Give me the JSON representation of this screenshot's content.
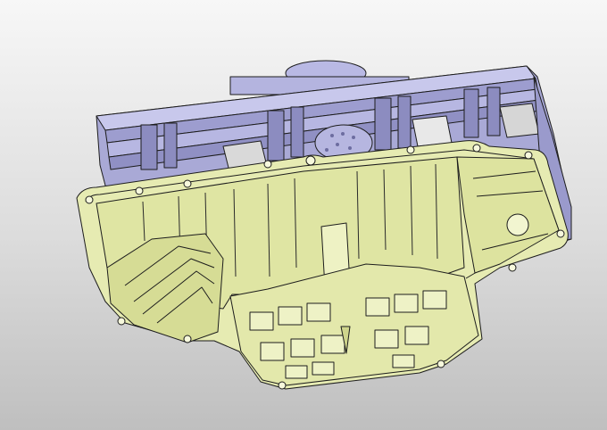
{
  "viewport": {
    "model_name": "oil-pan-assembly-3d-view",
    "render_mode": "shaded-with-edges"
  },
  "colors": {
    "background_top": "#f7f7f7",
    "background_bottom": "#bfbfbf",
    "pan_fill": "#e6ebb2",
    "pan_shadow": "#c9d08a",
    "frame_fill": "#a9a9d6",
    "frame_light": "#c8c8ec",
    "frame_dark": "#8585b8",
    "edge": "#1d1d1d"
  },
  "icons": {
    "part_frame": "mounting-frame-icon",
    "part_pan": "oil-pan-icon",
    "part_disc": "circular-plate-icon"
  }
}
